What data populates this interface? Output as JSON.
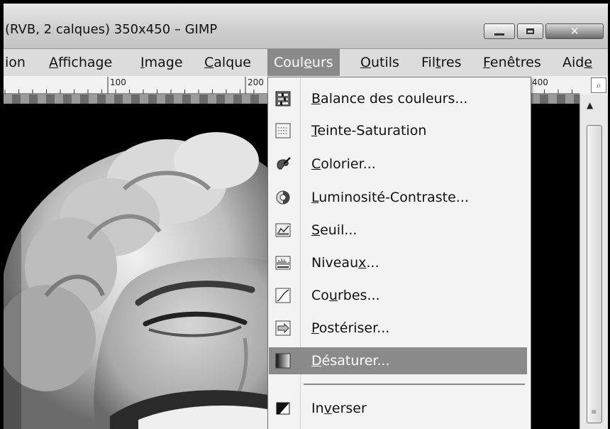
{
  "window": {
    "title": "(RVB, 2 calques) 350x450 – GIMP",
    "buttons": {
      "minimize": "minimize",
      "maximize": "maximize",
      "close": "✕"
    }
  },
  "menubar": {
    "items": [
      {
        "pre": "ion",
        "ul": "",
        "post": ""
      },
      {
        "pre": "",
        "ul": "A",
        "post": "ffichage"
      },
      {
        "pre": "",
        "ul": "I",
        "post": "mage"
      },
      {
        "pre": "",
        "ul": "C",
        "post": "alque"
      },
      {
        "pre": "Coul",
        "ul": "e",
        "post": "urs"
      },
      {
        "pre": "",
        "ul": "O",
        "post": "utils"
      },
      {
        "pre": "Fil",
        "ul": "t",
        "post": "res"
      },
      {
        "pre": "",
        "ul": "F",
        "post": "enêtres"
      },
      {
        "pre": "Aid",
        "ul": "e",
        "post": ""
      }
    ]
  },
  "ruler": {
    "labels": [
      "100",
      "200",
      "400"
    ],
    "zoom_icon": "zoom-icon"
  },
  "couleurs_menu": {
    "items": [
      {
        "pre": "",
        "ul": "B",
        "post": "alance des couleurs...",
        "icon": "color-balance-icon"
      },
      {
        "pre": "",
        "ul": "T",
        "post": "einte-Saturation",
        "icon": "hue-saturation-icon"
      },
      {
        "pre": "",
        "ul": "C",
        "post": "olorier...",
        "icon": "colorize-icon"
      },
      {
        "pre": "",
        "ul": "L",
        "post": "uminosité-Contraste...",
        "icon": "brightness-contrast-icon"
      },
      {
        "pre": "",
        "ul": "S",
        "post": "euil...",
        "icon": "threshold-icon"
      },
      {
        "pre": "Niveau",
        "ul": "x",
        "post": "...",
        "icon": "levels-icon"
      },
      {
        "pre": "Co",
        "ul": "u",
        "post": "rbes...",
        "icon": "curves-icon"
      },
      {
        "pre": "",
        "ul": "P",
        "post": "ostériser...",
        "icon": "posterize-icon"
      },
      {
        "pre": "",
        "ul": "D",
        "post": "ésaturer...",
        "icon": "desaturate-icon"
      },
      {
        "pre": "In",
        "ul": "v",
        "post": "erser",
        "icon": "invert-icon"
      }
    ],
    "highlighted": "Désaturer..."
  }
}
